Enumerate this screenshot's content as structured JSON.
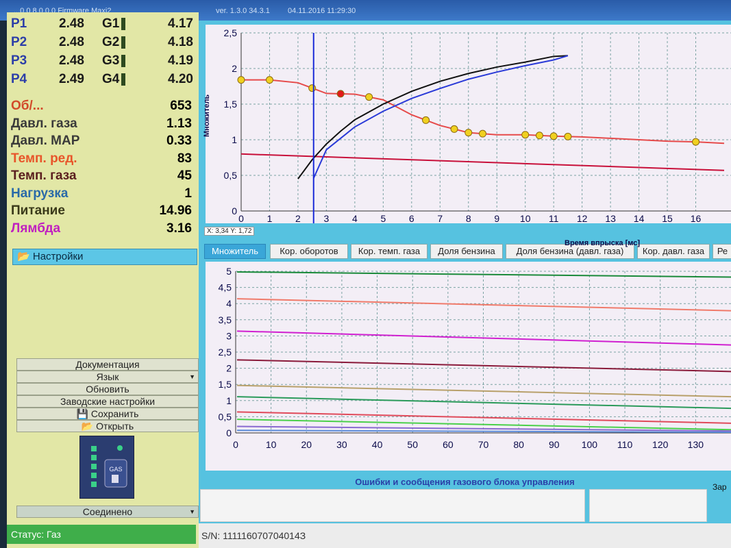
{
  "titlebar": {
    "left": "...0.0.8.0.0.0 Firmware Maxi2",
    "ver": "ver. 1.3.0  34.3.1",
    "date": "04.11.2016 11:29:30"
  },
  "pressure": [
    {
      "p": "P1",
      "pv": "2.48",
      "g": "G1",
      "gv": "4.17"
    },
    {
      "p": "P2",
      "pv": "2.48",
      "g": "G2",
      "gv": "4.18"
    },
    {
      "p": "P3",
      "pv": "2.48",
      "g": "G3",
      "gv": "4.19"
    },
    {
      "p": "P4",
      "pv": "2.49",
      "g": "G4",
      "gv": "4.20"
    }
  ],
  "params": [
    {
      "k": "Об/...",
      "v": "653",
      "color": "#d24a2a"
    },
    {
      "k": "Давл. газа",
      "v": "1.13",
      "color": "#3a3a3a"
    },
    {
      "k": "Давл. MAP",
      "v": "0.33",
      "color": "#3a3a3a"
    },
    {
      "k": "Темп. ред.",
      "v": "83",
      "color": "#e8552a"
    },
    {
      "k": "Темп. газа",
      "v": "45",
      "color": "#5a1e1e"
    },
    {
      "k": "Нагрузка",
      "v": "1",
      "color": "#2a6aa8"
    },
    {
      "k": "Питание",
      "v": "14.96",
      "color": "#3a3a1a"
    },
    {
      "k": "Лямбда",
      "v": "3.16",
      "color": "#c020c0"
    }
  ],
  "settings_label": "Настройки",
  "menu": [
    "Документация",
    "Язык",
    "Обновить",
    "Заводские настройки",
    "Сохранить",
    "Открыть"
  ],
  "connection": "Соединено",
  "status": "Статус: Газ",
  "gas_icon_label": "GAS",
  "cursor": {
    "label": "X: 3,34  Y: 1,72"
  },
  "tabs": [
    "Множитель",
    "Кор. оборотов",
    "Кор. темп. газа",
    "Доля бензина",
    "Доля бензина (давл. газа)",
    "Кор. давл. газа",
    "Ре"
  ],
  "error_title": "Ошибки и сообщения газового блока управления",
  "zar_label": "Зар",
  "serial": "S/N: 111116070704014З",
  "chart_data": [
    {
      "type": "line",
      "xlabel": "Время впрыска [мс]",
      "ylabel": "Множитель",
      "xlim": [
        0,
        17
      ],
      "ylim": [
        0,
        2.5
      ],
      "xticks": [
        "0",
        "1",
        "2",
        "3",
        "4",
        "5",
        "6",
        "7",
        "8",
        "9",
        "10",
        "11",
        "12",
        "13",
        "14",
        "15",
        "16"
      ],
      "yticks": [
        "0",
        "0,5",
        "1",
        "1,5",
        "2",
        "2,5"
      ],
      "cursor_x": 2.55,
      "series": [
        {
          "color": "#e64a4a",
          "x": [
            0,
            1,
            2,
            3,
            4,
            5,
            6,
            7,
            8,
            9,
            10,
            11,
            12,
            13,
            14,
            15,
            16,
            17
          ],
          "y": [
            1.84,
            1.84,
            1.8,
            1.65,
            1.64,
            1.56,
            1.35,
            1.2,
            1.1,
            1.07,
            1.07,
            1.05,
            1.04,
            1.02,
            1.0,
            0.98,
            0.97,
            0.95
          ]
        },
        {
          "color": "#c8103a",
          "x": [
            0,
            17
          ],
          "y": [
            0.8,
            0.57
          ]
        },
        {
          "color": "#111111",
          "x": [
            2,
            2.5,
            3,
            3.5,
            4,
            5,
            6,
            7,
            8,
            9,
            10,
            11,
            11.5
          ],
          "y": [
            0.45,
            0.72,
            0.94,
            1.12,
            1.28,
            1.5,
            1.68,
            1.82,
            1.93,
            2.02,
            2.09,
            2.17,
            2.18
          ]
        },
        {
          "color": "#2a3ad8",
          "x": [
            2.55,
            3,
            3.5,
            4,
            5,
            6,
            7,
            8,
            9,
            10,
            11,
            11.5
          ],
          "y": [
            0.46,
            0.86,
            1.02,
            1.18,
            1.4,
            1.58,
            1.72,
            1.85,
            1.95,
            2.04,
            2.12,
            2.18
          ]
        }
      ],
      "markers": [
        0,
        1,
        2.5,
        3.5,
        4.5,
        6.5,
        7.5,
        8,
        8.5,
        10,
        10.5,
        11,
        11.5,
        16
      ]
    },
    {
      "type": "line",
      "xlim": [
        0,
        140
      ],
      "ylim": [
        0,
        5
      ],
      "xticks": [
        "0",
        "10",
        "20",
        "30",
        "40",
        "50",
        "60",
        "70",
        "80",
        "90",
        "100",
        "110",
        "120",
        "130"
      ],
      "yticks": [
        "0",
        "0,5",
        "1",
        "1,5",
        "2",
        "2,5",
        "3",
        "3,5",
        "4",
        "4,5",
        "5"
      ],
      "series": [
        {
          "color": "#1a8a3a",
          "y0": 4.98,
          "y1": 4.82
        },
        {
          "color": "#f07a6a",
          "y0": 4.15,
          "y1": 3.78
        },
        {
          "color": "#d020d0",
          "y0": 3.15,
          "y1": 2.72
        },
        {
          "color": "#8a1a3a",
          "y0": 2.26,
          "y1": 1.9
        },
        {
          "color": "#b8a06a",
          "y0": 1.47,
          "y1": 1.12
        },
        {
          "color": "#2a9a5a",
          "y0": 1.12,
          "y1": 0.76
        },
        {
          "color": "#e04a5a",
          "y0": 0.65,
          "y1": 0.3
        },
        {
          "color": "#4ad04a",
          "y0": 0.42,
          "y1": 0.1
        },
        {
          "color": "#8a6ad0",
          "y0": 0.2,
          "y1": 0.06
        },
        {
          "color": "#5a8ad8",
          "y0": 0.08,
          "y1": 0.02
        }
      ]
    }
  ]
}
